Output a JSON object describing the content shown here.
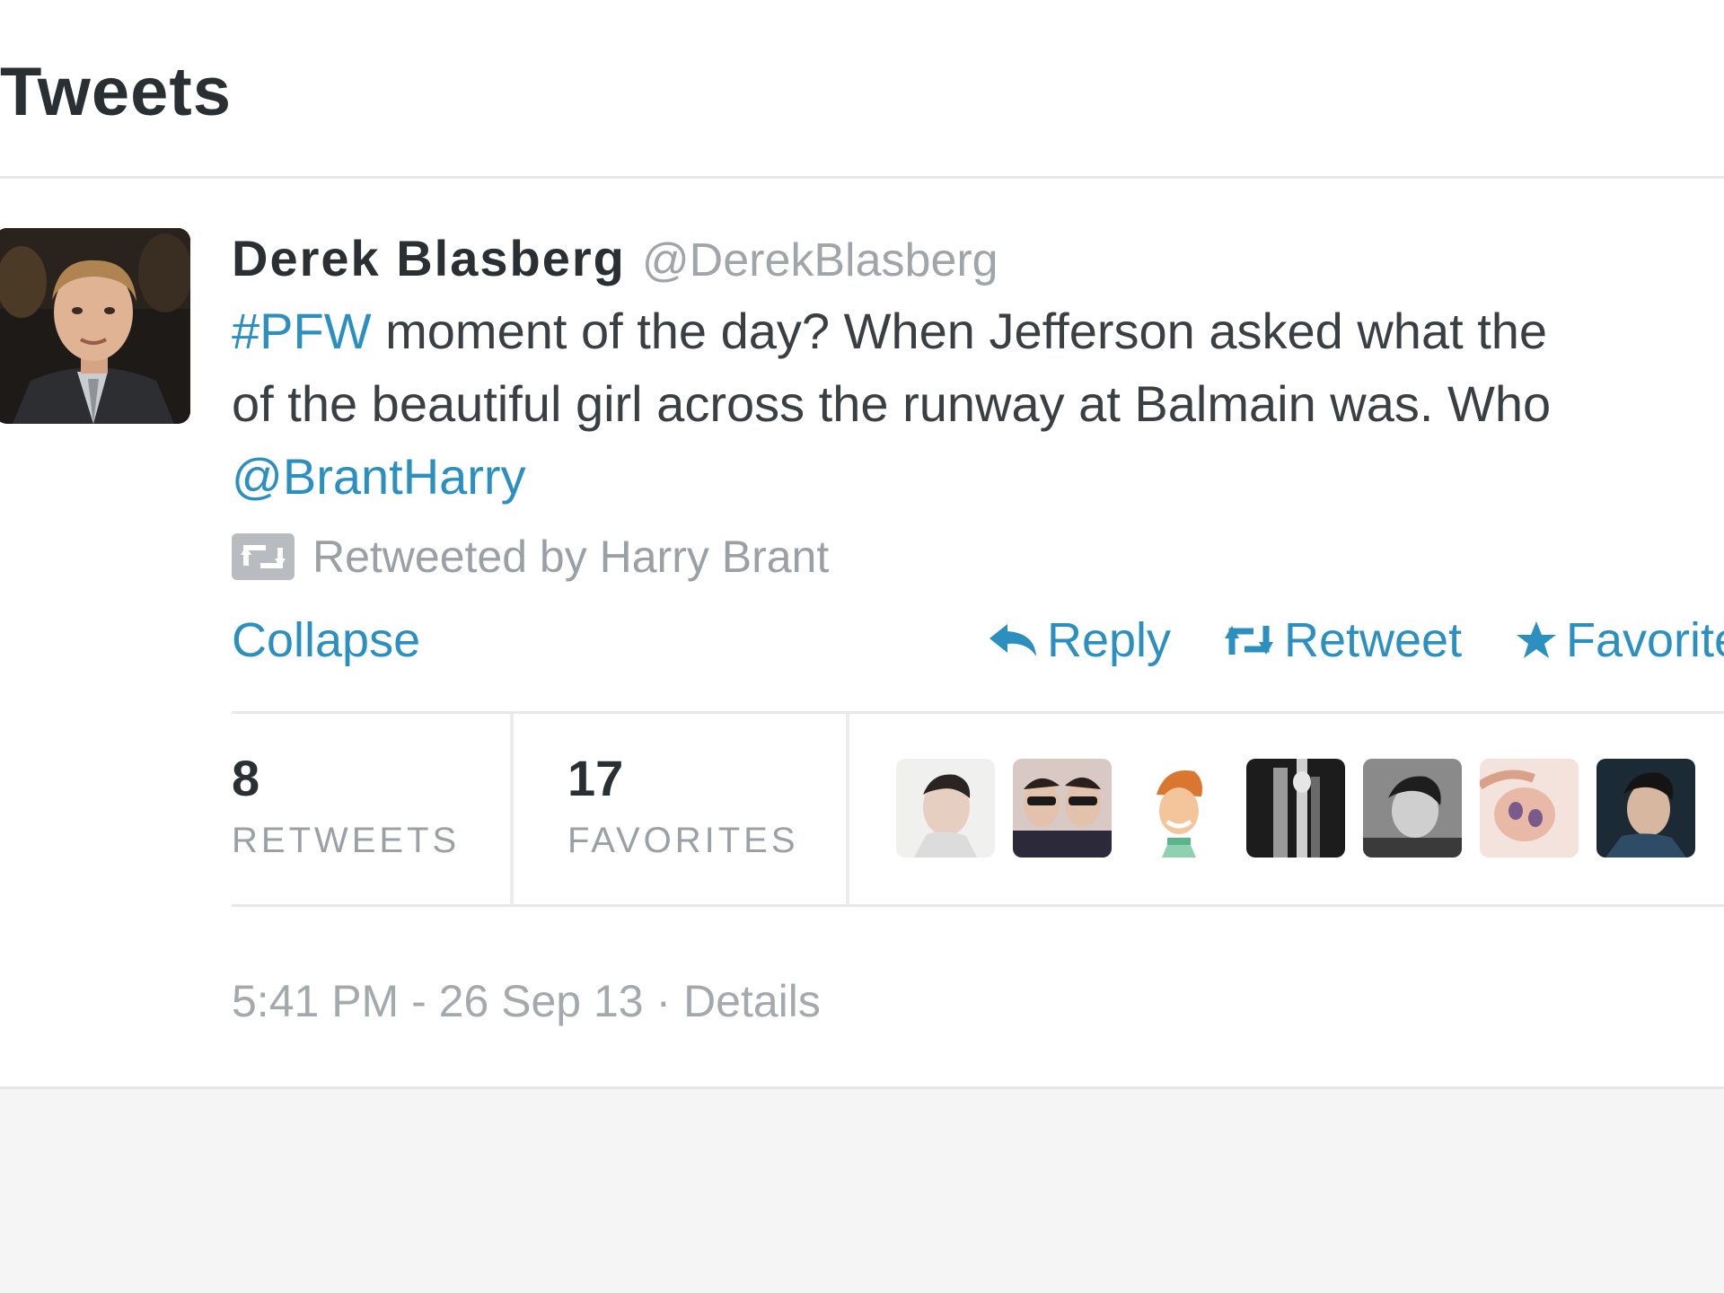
{
  "header": {
    "title": "Tweets"
  },
  "tweet": {
    "author_name": "Derek Blasberg",
    "author_handle": "@DerekBlasberg",
    "text_line1_link": "#PFW",
    "text_line1_rest": " moment of the day? When Jefferson asked what the",
    "text_line2": "of the beautiful girl across the runway at Balmain was. Who",
    "text_line3_link": "@BrantHarry",
    "retweeted_by": "Retweeted by Harry Brant",
    "collapse_label": "Collapse",
    "reply_label": "Reply",
    "retweet_label": "Retweet",
    "favorite_label": "Favorite",
    "retweets_count": "8",
    "retweets_label": "RETWEETS",
    "favorites_count": "17",
    "favorites_label": "FAVORITES",
    "timestamp": "5:41 PM - 26 Sep 13",
    "separator": " · ",
    "details_label": "Details"
  },
  "icons": {
    "reply": "reply-arrow-icon",
    "retweet": "retweet-icon",
    "favorite": "star-icon",
    "retweeted_by": "retweet-box-icon"
  },
  "colors": {
    "link": "#2b8fc0",
    "text": "#3a3f44",
    "muted": "#9aa0a5"
  }
}
